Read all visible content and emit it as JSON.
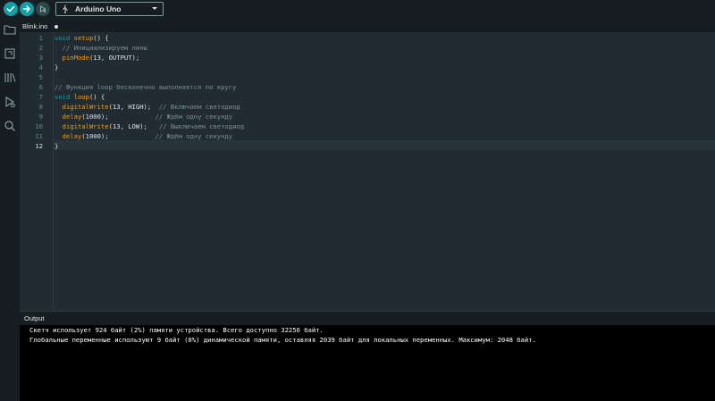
{
  "toolbar": {
    "board": "Arduino Uno",
    "verify_icon": "check-icon",
    "upload_icon": "arrow-right-icon",
    "debug_icon": "debug-icon"
  },
  "sidebar": {
    "items": [
      {
        "name": "sketchbook",
        "icon": "folder-icon"
      },
      {
        "name": "boards-manager",
        "icon": "board-icon"
      },
      {
        "name": "library-manager",
        "icon": "library-icon"
      },
      {
        "name": "debug",
        "icon": "debug-icon"
      },
      {
        "name": "search",
        "icon": "search-icon"
      }
    ]
  },
  "tab": {
    "filename": "Blink.ino"
  },
  "editor": {
    "line_numbers": [
      "1",
      "2",
      "3",
      "4",
      "5",
      "6",
      "7",
      "8",
      "9",
      "10",
      "11",
      "12"
    ],
    "active_line": 12,
    "lines": [
      [
        {
          "t": "kw",
          "v": "void"
        },
        {
          "t": "p",
          "v": " "
        },
        {
          "t": "fn",
          "v": "setup"
        },
        {
          "t": "p",
          "v": "() {"
        }
      ],
      [
        {
          "t": "p",
          "v": "  "
        },
        {
          "t": "cm",
          "v": "// Инициализируем пины"
        }
      ],
      [
        {
          "t": "p",
          "v": "  "
        },
        {
          "t": "fn",
          "v": "pinMode"
        },
        {
          "t": "p",
          "v": "(13, OUTPUT);"
        }
      ],
      [
        {
          "t": "p",
          "v": "}"
        }
      ],
      [
        {
          "t": "p",
          "v": ""
        }
      ],
      [
        {
          "t": "cm",
          "v": "// Функция loop бесконечно выполняется по кругу"
        }
      ],
      [
        {
          "t": "kw",
          "v": "void"
        },
        {
          "t": "p",
          "v": " "
        },
        {
          "t": "fn",
          "v": "loop"
        },
        {
          "t": "p",
          "v": "() {"
        }
      ],
      [
        {
          "t": "p",
          "v": "  "
        },
        {
          "t": "fn",
          "v": "digitalWrite"
        },
        {
          "t": "p",
          "v": "(13, HIGH);  "
        },
        {
          "t": "cm",
          "v": "// Включаем светодиод"
        }
      ],
      [
        {
          "t": "p",
          "v": "  "
        },
        {
          "t": "fn",
          "v": "delay"
        },
        {
          "t": "p",
          "v": "(1000);            "
        },
        {
          "t": "cm",
          "v": "// Ждём одну секунду"
        }
      ],
      [
        {
          "t": "p",
          "v": "  "
        },
        {
          "t": "fn",
          "v": "digitalWrite"
        },
        {
          "t": "p",
          "v": "(13, LOW);   "
        },
        {
          "t": "cm",
          "v": "// Выключаем светодиод"
        }
      ],
      [
        {
          "t": "p",
          "v": "  "
        },
        {
          "t": "fn",
          "v": "delay"
        },
        {
          "t": "p",
          "v": "(1000);            "
        },
        {
          "t": "cm",
          "v": "// Ждём одну секунду"
        }
      ],
      [
        {
          "t": "p",
          "v": "}"
        }
      ]
    ]
  },
  "output": {
    "title": "Output",
    "lines": [
      "Скетч использует 924 байт (2%) памяти устройства. Всего доступно 32256 байт.",
      "Глобальные переменные используют 9 байт (0%) динамической памяти, оставляя 2039 байт для локальных переменных. Максимум: 2048 байт."
    ]
  },
  "colors": {
    "accent": "#0ca1a6",
    "keyword": "#0ca1a6",
    "function": "#f39c12",
    "comment": "#7f8c8d",
    "editor_bg": "#202c32",
    "output_bg": "#000000"
  }
}
